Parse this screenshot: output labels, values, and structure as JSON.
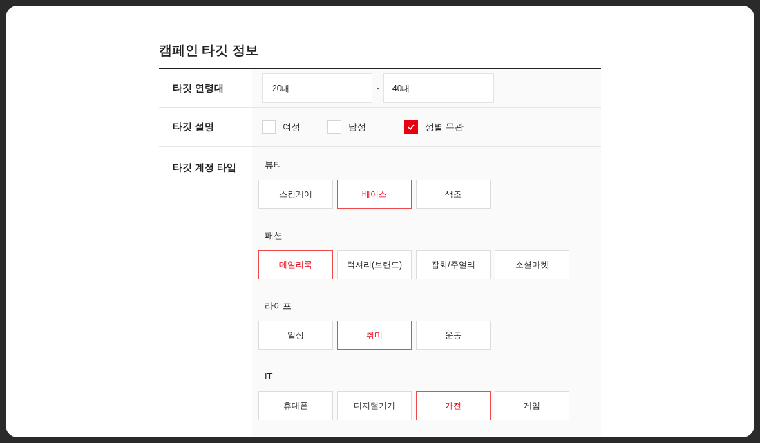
{
  "title": "캠페인 타깃 정보",
  "age": {
    "label": "타깃 연령대",
    "from": "20대",
    "separator": "-",
    "to": "40대"
  },
  "gender": {
    "label": "타깃 설명",
    "options": [
      {
        "label": "여성",
        "checked": false
      },
      {
        "label": "남성",
        "checked": false
      },
      {
        "label": "성별 무관",
        "checked": true
      }
    ]
  },
  "account_type": {
    "label": "타깃 계정 타입",
    "groups": [
      {
        "name": "뷰티",
        "options": [
          {
            "label": "스킨케어",
            "selected": false
          },
          {
            "label": "베이스",
            "selected": true
          },
          {
            "label": "색조",
            "selected": false
          }
        ]
      },
      {
        "name": "패션",
        "options": [
          {
            "label": "데일리룩",
            "selected": true
          },
          {
            "label": "럭셔리(브랜드)",
            "selected": false
          },
          {
            "label": "잡화/주얼리",
            "selected": false
          },
          {
            "label": "소셜마켓",
            "selected": false
          }
        ]
      },
      {
        "name": "라이프",
        "options": [
          {
            "label": "일상",
            "selected": false
          },
          {
            "label": "취미",
            "selected": true
          },
          {
            "label": "운동",
            "selected": false
          }
        ]
      },
      {
        "name": "IT",
        "options": [
          {
            "label": "휴대폰",
            "selected": false
          },
          {
            "label": "디지털기기",
            "selected": false
          },
          {
            "label": "가전",
            "selected": true
          },
          {
            "label": "게임",
            "selected": false
          }
        ]
      }
    ]
  }
}
